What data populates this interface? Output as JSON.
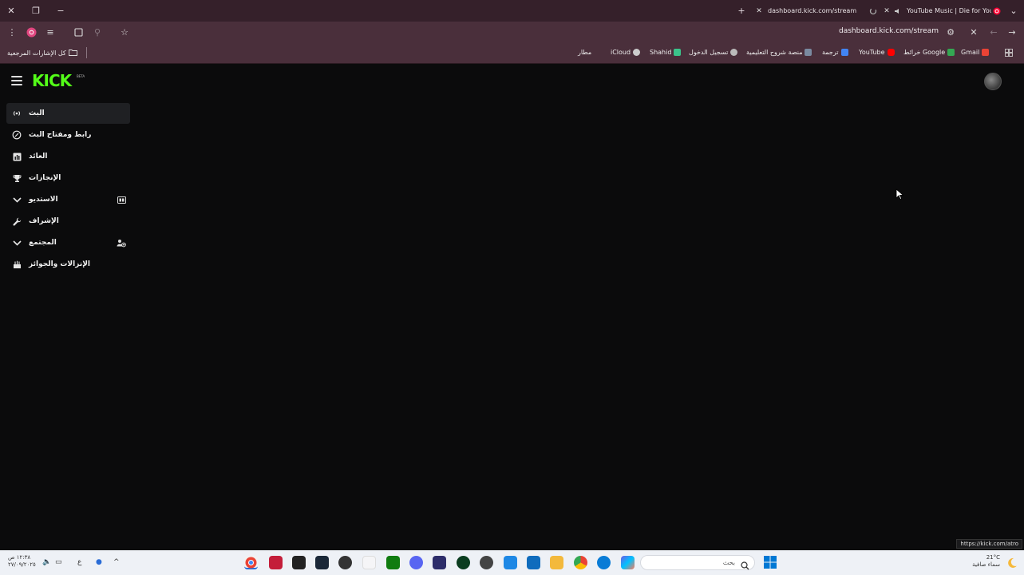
{
  "browser": {
    "tabs": [
      {
        "title": "dashboard.kick.com/stream",
        "active": true
      },
      {
        "title": "YouTube Music | Die for You",
        "active": false
      }
    ],
    "url": "dashboard.kick.com/stream",
    "bookmarks": [
      {
        "label": "Gmail",
        "color": "#ea4335"
      },
      {
        "label": "خرائط Google",
        "color": "#34a853"
      },
      {
        "label": "YouTube",
        "color": "#ff0000"
      },
      {
        "label": "ترجمة",
        "color": "#4285f4"
      },
      {
        "label": "منصة شروح التعليمية",
        "color": "#7a8aa0"
      },
      {
        "label": "تسجيل الدخول",
        "color": "#bbbbbb"
      },
      {
        "label": "Shahid",
        "color": "#3bc48b"
      },
      {
        "label": "iCloud",
        "color": "#cccccc"
      },
      {
        "label": "مطار",
        "color": "#999999"
      }
    ],
    "all_bookmarks_label": "كل الإشارات المرجعية"
  },
  "app": {
    "logo": "KICK",
    "logo_badge": "BETA",
    "accent": "#53fc18",
    "nav": [
      {
        "label": "البث",
        "icon": "live-icon",
        "active": true
      },
      {
        "label": "رابط ومفتاح البث",
        "icon": "link-icon",
        "active": false
      },
      {
        "label": "العائد",
        "icon": "analytics-icon",
        "active": false
      },
      {
        "label": "الإنجازات",
        "icon": "trophy-icon",
        "active": false
      },
      {
        "label": "الاستديو",
        "icon": "chevron-down-icon",
        "trailing_icon": "studio-icon",
        "active": false
      },
      {
        "label": "الإشراف",
        "icon": "wrench-icon",
        "active": false
      },
      {
        "label": "المجتمع",
        "icon": "chevron-down-icon",
        "trailing_icon": "community-icon",
        "active": false
      },
      {
        "label": "الإنزالات والجوائز",
        "icon": "drops-icon",
        "active": false
      }
    ]
  },
  "status_bar_url": "https://kick.com/atro",
  "taskbar": {
    "clock_time": "١٢:٣٨ ص",
    "clock_date": "٢٧/٠٩/٢٠٢٥",
    "language": "ع",
    "search_placeholder": "بحث",
    "weather_temp": "21°C",
    "weather_desc": "سماء صافية"
  }
}
